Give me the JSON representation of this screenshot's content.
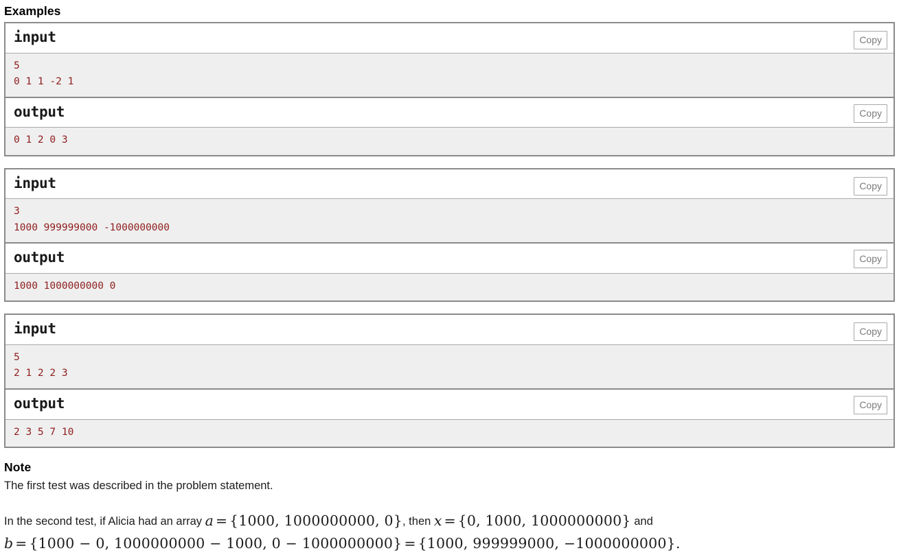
{
  "page": {
    "examples_heading": "Examples",
    "note_heading": "Note"
  },
  "copy_label": "Copy",
  "io_labels": {
    "input": "input",
    "output": "output"
  },
  "examples": [
    {
      "input": "5\n0 1 1 -2 1",
      "output": "0 1 2 0 3"
    },
    {
      "input": "3\n1000 999999000 -1000000000",
      "output": "1000 1000000000 0"
    },
    {
      "input": "5\n2 1 2 2 3",
      "output": "2 3 5 7 10"
    }
  ],
  "note": {
    "paragraph1": "The first test was described in the problem statement.",
    "paragraph2": {
      "lead_text": "In the second test, if Alicia had an array ",
      "var_a": "a",
      "eq1": "=",
      "set_a": "{1000, 1000000000, 0}",
      "comma_then": ", then ",
      "var_x": "x",
      "eq2": "=",
      "set_x": "{0, 1000, 1000000000}",
      "and_text": " and",
      "var_b": "b",
      "eq3": "=",
      "set_b_expr": "{1000 − 0, 1000000000 − 1000, 0 − 1000000000}",
      "eq4": "=",
      "set_b_val": "{1000, 999999000, −1000000000}",
      "period": "."
    }
  },
  "colors": {
    "code_text": "#8f1d1d",
    "code_bg": "#efefef",
    "block_border": "#8a8a8a",
    "copy_border": "#a8a8a8",
    "copy_text": "#7b7b7b"
  }
}
